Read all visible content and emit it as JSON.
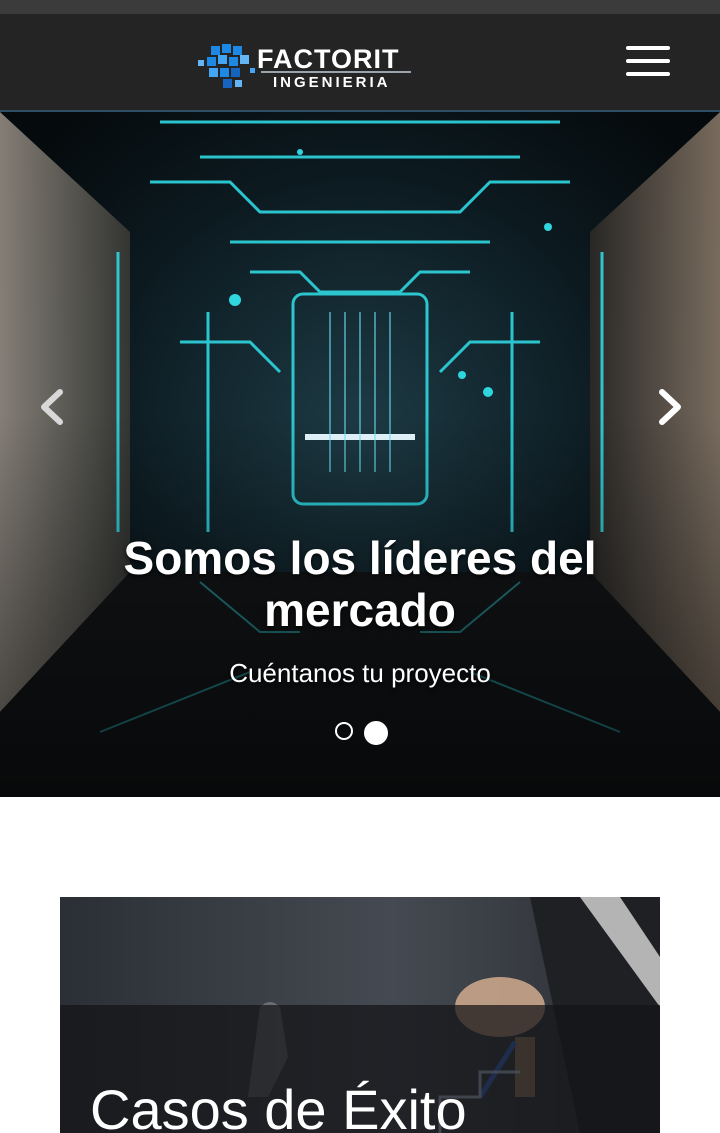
{
  "header": {
    "logo_text": "FACTORIT",
    "logo_subtext": "INGENIERIA",
    "menu_icon": "hamburger-menu-icon"
  },
  "carousel": {
    "slide_title": "Somos los líderes del mercado",
    "slide_subtitle": "Cuéntanos tu proyecto",
    "prev_icon": "chevron-left-icon",
    "next_icon": "chevron-right-icon",
    "active_slide": 2,
    "slide_count": 2
  },
  "cases_card": {
    "title": "Casos de Éxito"
  },
  "colors": {
    "navbar": "#242424",
    "accent_cyan": "#2fd6e0",
    "logo_blue": "#1e88e5"
  }
}
